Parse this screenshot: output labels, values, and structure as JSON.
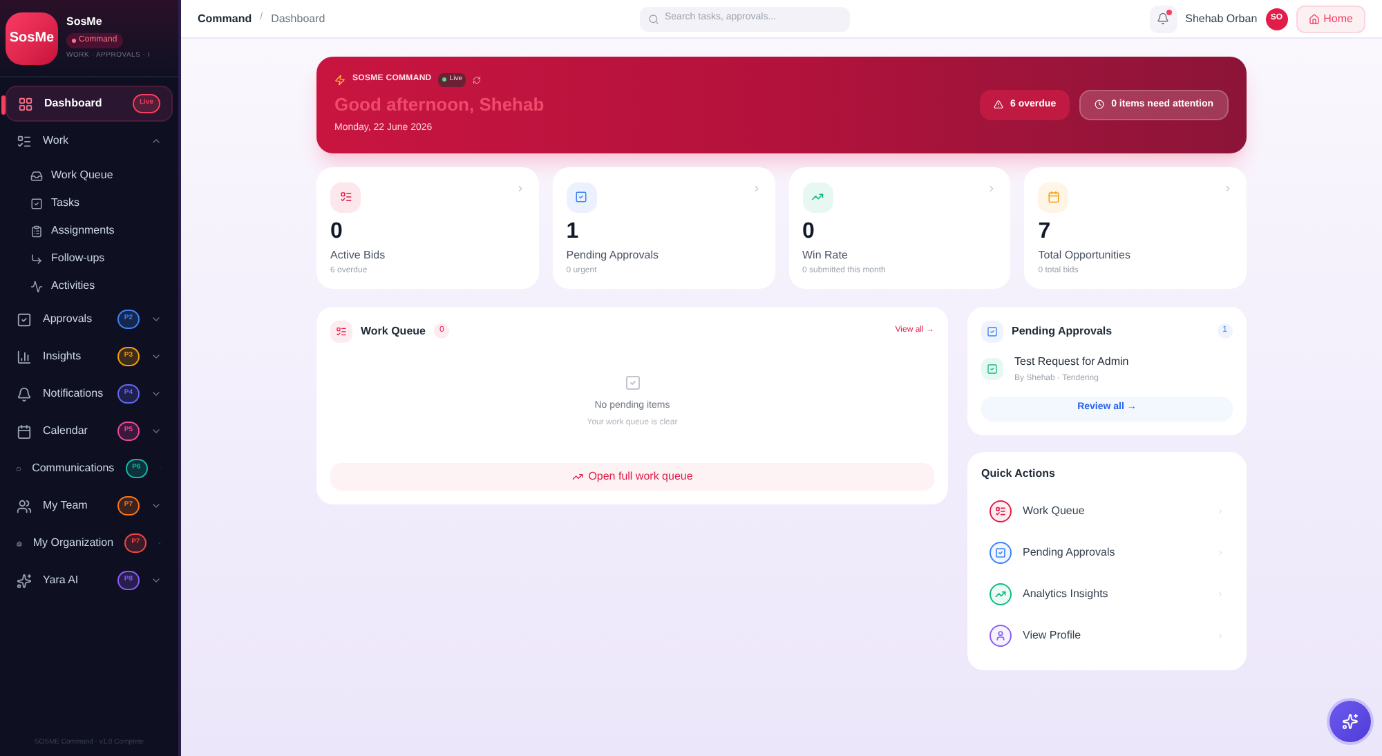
{
  "sidebar": {
    "logo": "SosMe",
    "name": "SosMe",
    "tag": "Command",
    "tagline": "WORK · APPROVALS · I",
    "items": [
      {
        "label": "Dashboard",
        "selected": true,
        "badge": {
          "text": "Live",
          "color": "#f43f5e"
        }
      },
      {
        "label": "Work",
        "selected": false,
        "expanded": true,
        "children": [
          {
            "label": "Work Queue",
            "selected": false
          },
          {
            "label": "Tasks",
            "selected": false
          },
          {
            "label": "Assignments",
            "selected": false
          },
          {
            "label": "Follow-ups",
            "selected": false
          },
          {
            "label": "Activities",
            "selected": false
          }
        ]
      },
      {
        "label": "Approvals",
        "selected": false,
        "expanded": false,
        "badge": {
          "text": "P2",
          "color": "#3b82f6"
        }
      },
      {
        "label": "Insights",
        "selected": false,
        "expanded": false,
        "badge": {
          "text": "P3",
          "color": "#f59e0b"
        }
      },
      {
        "label": "Notifications",
        "selected": false,
        "expanded": false,
        "badge": {
          "text": "P4",
          "color": "#6366f1"
        }
      },
      {
        "label": "Calendar",
        "selected": false,
        "expanded": false,
        "badge": {
          "text": "P5",
          "color": "#ec4899"
        }
      },
      {
        "label": "Communications",
        "selected": false,
        "expanded": false,
        "badge": {
          "text": "P6",
          "color": "#14b8a6"
        }
      },
      {
        "label": "My Team",
        "selected": false,
        "expanded": false,
        "badge": {
          "text": "P7",
          "color": "#f97316"
        }
      },
      {
        "label": "My Organization",
        "selected": false,
        "expanded": false,
        "badge": {
          "text": "P7",
          "color": "#ef4444"
        }
      },
      {
        "label": "Yara AI",
        "selected": false,
        "expanded": false,
        "badge": {
          "text": "P8",
          "color": "#8b5cf6"
        }
      }
    ],
    "footer": "SOSME Command · v1.0 Complete"
  },
  "topbar": {
    "breadcrumbs": [
      "Command",
      "Dashboard"
    ],
    "breadcrumb_separator": "/",
    "search": {
      "placeholder": "Search tasks, approvals..."
    },
    "notifications": {
      "unread": true
    },
    "user": "Shehab Orban",
    "avatar": "SO",
    "home": "Home"
  },
  "hero": {
    "eyebrow": "SOSME COMMAND",
    "live": "Live",
    "greeting": "Good afternoon, Shehab",
    "date": "Monday, 22 June 2026",
    "chips": [
      "6 overdue",
      "0 items need attention"
    ]
  },
  "stats": [
    {
      "value": "0",
      "label": "Active Bids",
      "sub": "6 overdue",
      "color": "#e11d48"
    },
    {
      "value": "1",
      "label": "Pending Approvals",
      "sub": "0 urgent",
      "color": "#3b82f6"
    },
    {
      "value": "0",
      "label": "Win Rate",
      "sub": "0 submitted this month",
      "color": "#10b981"
    },
    {
      "value": "7",
      "label": "Total Opportunities",
      "sub": "0 total bids",
      "color": "#f59e0b"
    }
  ],
  "work_queue": {
    "title": "Work Queue",
    "count": "0",
    "view_all": "View all →",
    "empty_title": "No pending items",
    "empty_sub": "Your work queue is clear",
    "open": "Open full work queue"
  },
  "pending": {
    "title": "Pending Approvals",
    "count": "1",
    "items": [
      {
        "title": "Test Request for Admin",
        "sub": "By Shehab · Tendering"
      }
    ],
    "review": "Review all →"
  },
  "quick_actions": {
    "title": "Quick Actions",
    "items": [
      {
        "label": "Work Queue",
        "color": "#e11d48"
      },
      {
        "label": "Pending Approvals",
        "color": "#3b82f6"
      },
      {
        "label": "Analytics Insights",
        "color": "#10b981"
      },
      {
        "label": "View Profile",
        "color": "#8b5cf6"
      }
    ]
  }
}
